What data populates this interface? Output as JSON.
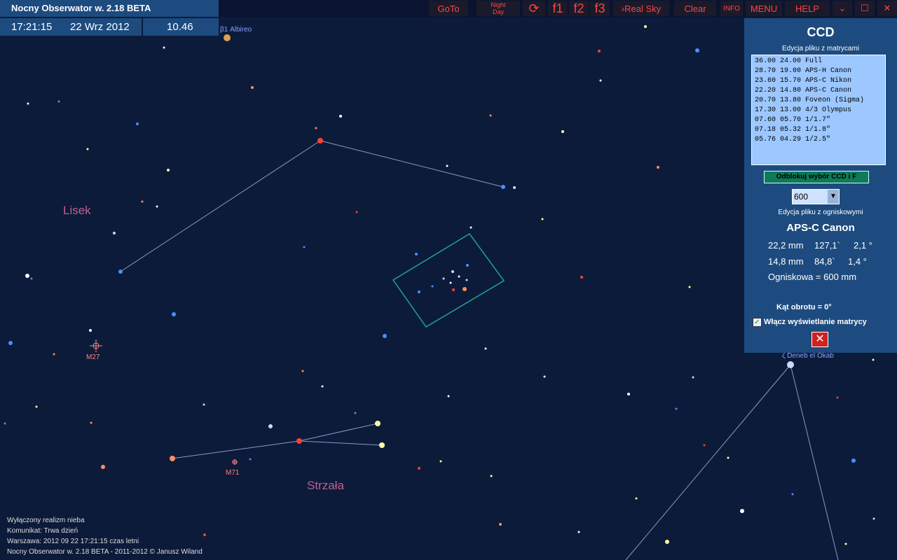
{
  "app": {
    "title": "Nocny Obserwator w. 2.18 BETA"
  },
  "toolbar": {
    "goto": "GoTo",
    "night": "Night",
    "day": "Day",
    "refresh_icon": "refresh-icon",
    "f1": "f1",
    "f2": "f2",
    "f3": "f3",
    "realsky": "Real Sky",
    "clear": "Clear",
    "info": "INFO",
    "menu": "MENU",
    "help": "HELP",
    "chevron_icon": "chevron-down-icon",
    "maximize_icon": "maximize-icon",
    "close_icon": "close-icon"
  },
  "clock": {
    "time": "17:21:15",
    "date": "22 Wrz 2012",
    "zoom": "10.46"
  },
  "sky": {
    "constellations": [
      "Lisek",
      "Strzała"
    ],
    "star_labels": [
      "β1 Albireo",
      "ζ Deneb el Okab"
    ],
    "objects": [
      "M27",
      "M71"
    ]
  },
  "ccd_panel": {
    "title": "CCD",
    "matrices_caption": "Edycja pliku z matrycami",
    "matrices": [
      "36.00 24.00 Full",
      "28.70 19.00 APS-H Canon",
      "23.60 15.70 APS-C Nikon",
      "22.20 14.80 APS-C Canon",
      "20.70 13.80 Foveon (Sigma)",
      "17.30 13.00 4/3 Olympus",
      "07.60 05.70 1/1.7\"",
      "07.18 05.32 1/1.8\"",
      "05.76 04.29 1/2.5\""
    ],
    "unlock_button": "Odblokuj wybór CCD i F",
    "focal_select": "600",
    "focal_caption": "Edycja pliku z ogniskowymi",
    "sensor_name": "APS-C Canon",
    "row1": {
      "mm": "22,2 mm",
      "arcmin": "127,1`",
      "deg": "2,1 °"
    },
    "row2": {
      "mm": "14,8 mm",
      "arcmin": "84,8`",
      "deg": "1,4 °"
    },
    "focal_length": "Ogniskowa = 600 mm",
    "rotation": "Kąt obrotu = 0°",
    "checkbox_label": "Włącz wyświetlanie matrycy",
    "checkbox_checked": true
  },
  "status": {
    "line1": "Wyłączony realizm nieba",
    "line2": "Komunikat: Trwa dzień",
    "line3": "Warszawa:  2012 09 22  17:21:15 czas letni",
    "line4": "Nocny Obserwator w. 2.18 BETA - 2011-2012 © Janusz Wiland"
  },
  "colors": {
    "sky_bg": "#0c1b3a",
    "bar_bg": "#1d4b7f",
    "button_text": "#ff4444",
    "constellation_label": "#c06090",
    "ccd_frame": "#20a0a0"
  }
}
